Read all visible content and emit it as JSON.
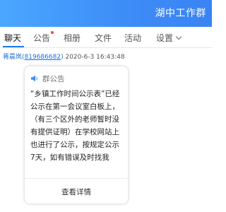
{
  "window": {
    "group_name": "湖中工作群"
  },
  "tabs": [
    {
      "label": "聊天",
      "active": true
    },
    {
      "label": "公告",
      "has_badge": true
    },
    {
      "label": "相册"
    },
    {
      "label": "文件"
    },
    {
      "label": "活动"
    },
    {
      "label": "设置"
    }
  ],
  "message": {
    "sender_name": "蒋晨岚",
    "sender_qq": "819686682",
    "open_paren": "(",
    "close_paren": ")",
    "timestamp": "2020-6-3 16:43:48"
  },
  "announcement": {
    "header_label": "群公告",
    "body": "“乡镇工作时间公示表”已经公示在第一会议室白板上，（有三个区外的老师暂时没有提供证明）在学校网站上也进行了公示，按规定公示7天，如有错误及时找我",
    "view_details_label": "查看详情"
  },
  "colors": {
    "title_bar": "#3d8cf7",
    "link_blue": "#1a6fd8",
    "tab_underline": "#1e7cf2",
    "badge_red": "#f04646"
  }
}
